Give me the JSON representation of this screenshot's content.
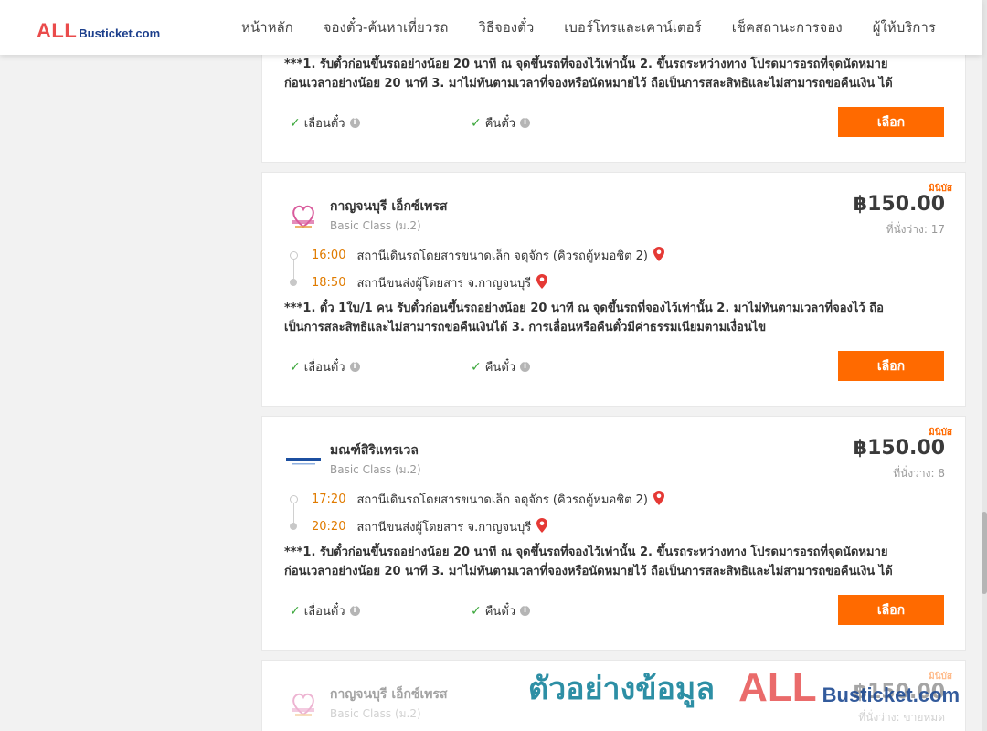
{
  "header": {
    "logo_big": "ALL",
    "logo_small": "Busticket.com",
    "nav": [
      "หน้าหลัก",
      "จองตั๋ว-ค้นหาเที่ยวรถ",
      "วิธีจองตั๋ว",
      "เบอร์โทรและเคาน์เตอร์",
      "เช็คสถานะการจอง",
      "ผู้ให้บริการ"
    ]
  },
  "labels": {
    "reschedule": "เลื่อนตั๋ว",
    "refund": "คืนตั๋ว",
    "select": "เลือก"
  },
  "colors": {
    "accent": "#ff6a00",
    "time": "#e07b00",
    "check": "#3aa63a"
  },
  "cards": [
    {
      "note_lines": [
        "***1. รับตั๋วก่อนขึ้นรถอย่างน้อย 20 นาที ณ จุดขึ้นรถที่จองไว้เท่านั้น 2. ขึ้นรถระหว่างทาง โปรดมารอรถที่จุดนัดหมาย",
        "ก่อนเวลาอย่างน้อย 20 นาที 3. มาไม่ทันตามเวลาที่จองหรือนัดหมายไว้ ถือเป็นการสละสิทธิและไม่สามารถขอคืนเงิน ได้"
      ]
    },
    {
      "type": "มินิบัส",
      "operator": "กาญจนบุรี เอ็กซ์เพรส",
      "class": "Basic Class (ม.2)",
      "price": "฿150.00",
      "seats": "ที่นั่งว่าง: 17",
      "depart_time": "16:00",
      "depart_station": "สถานีเดินรถโดยสารขนาดเล็ก จตุจักร (คิวรถตู้หมอชิต 2)",
      "arrive_time": "18:50",
      "arrive_station": "สถานีขนส่งผู้โดยสาร จ.กาญจนบุรี",
      "note_lines": [
        "***1. ตั๋ว 1ใบ/1 คน รับตั๋วก่อนขึ้นรถอย่างน้อย 20 นาที ณ จุดขึ้นรถที่จองไว้เท่านั้น 2. มาไม่ทันตามเวลาที่จองไว้ ถือ",
        "เป็นการสละสิทธิและไม่สามารถขอคืนเงินได้ 3. การเลื่อนหรือคืนตั๋วมีค่าธรรมเนียมตามเงื่อนไข"
      ]
    },
    {
      "type": "มินิบัส",
      "operator": "มณฑ์สิริแทรเวล",
      "class": "Basic Class (ม.2)",
      "price": "฿150.00",
      "seats": "ที่นั่งว่าง: 8",
      "depart_time": "17:20",
      "depart_station": "สถานีเดินรถโดยสารขนาดเล็ก จตุจักร (คิวรถตู้หมอชิต 2)",
      "arrive_time": "20:20",
      "arrive_station": "สถานีขนส่งผู้โดยสาร จ.กาญจนบุรี",
      "note_lines": [
        "***1. รับตั๋วก่อนขึ้นรถอย่างน้อย 20 นาที ณ จุดขึ้นรถที่จองไว้เท่านั้น 2. ขึ้นรถระหว่างทาง โปรดมารอรถที่จุดนัดหมาย",
        "ก่อนเวลาอย่างน้อย 20 นาที 3. มาไม่ทันตามเวลาที่จองหรือนัดหมายไว้ ถือเป็นการสละสิทธิและไม่สามารถขอคืนเงิน ได้"
      ]
    },
    {
      "type": "มินิบัส",
      "operator": "กาญจนบุรี เอ็กซ์เพรส",
      "class": "Basic Class (ม.2)",
      "price": "฿150.00",
      "seats": "ที่นั่งว่าง: ขายหมด"
    }
  ],
  "watermark": {
    "text": "ตัวอย่างข้อมูล",
    "logo_big": "ALL",
    "logo_small": "Busticket.com"
  }
}
